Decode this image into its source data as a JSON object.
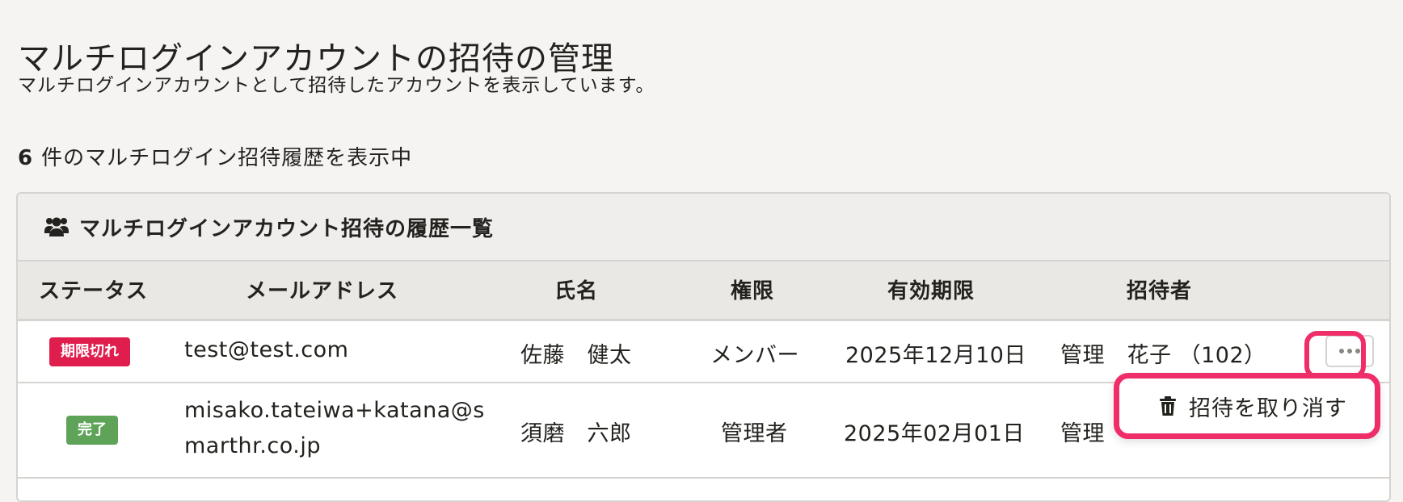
{
  "page": {
    "title": "マルチログインアカウントの招待の管理",
    "description": "マルチログインアカウントとして招待したアカウントを表示しています。"
  },
  "result": {
    "count": "6",
    "label": "件のマルチログイン招待履歴を表示中"
  },
  "panel": {
    "title": "マルチログインアカウント招待の履歴一覧",
    "icon": "users-icon"
  },
  "table": {
    "headers": {
      "status": "ステータス",
      "email": "メールアドレス",
      "name": "氏名",
      "role": "権限",
      "expiry": "有効期限",
      "inviter": "招待者"
    },
    "rows": [
      {
        "status": "期限切れ",
        "status_color": "#e01e4d",
        "email": "test@test.com",
        "name": "佐藤　健太",
        "role": "メンバー",
        "expiry": "2025年12月10日",
        "inviter": "管理　花子 （102）"
      },
      {
        "status": "完了",
        "status_color": "#5ea357",
        "email_line1": "misako.tateiwa+katana@s",
        "email_line2": "marthr.co.jp",
        "name": "須磨　六郎",
        "role": "管理者",
        "expiry": "2025年02月01日",
        "inviter": "管理"
      }
    ]
  },
  "row_menu": {
    "items": [
      {
        "label": "招待を取り消す",
        "icon": "trash-icon"
      }
    ]
  },
  "colors": {
    "highlight": "#ef2d68",
    "expired": "#e01e4d",
    "completed": "#5ea357",
    "background": "#f5f4f2"
  }
}
